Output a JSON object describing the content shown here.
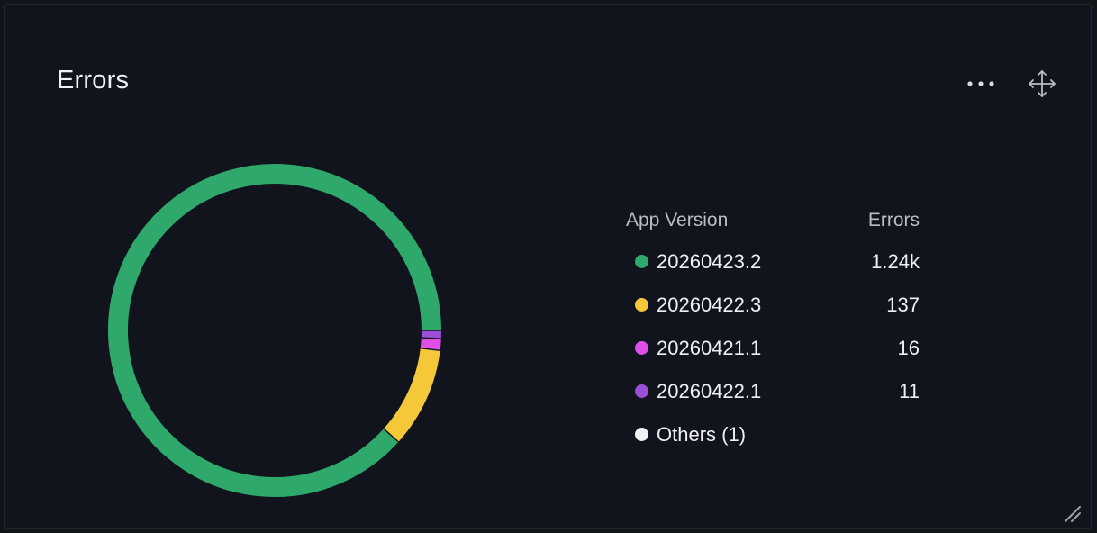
{
  "panel": {
    "title": "Errors",
    "menu_icon": "more-horizontal-icon",
    "move_icon": "move-arrows-icon",
    "resize_icon": "resize-handle-icon"
  },
  "colors": {
    "background": "#11141c",
    "green": "#2ea86b",
    "yellow": "#f5c839",
    "magenta": "#df4fe7",
    "purple": "#9a4fd8",
    "white": "#f2f3f5"
  },
  "chart_data": {
    "type": "pie",
    "title": "Errors",
    "legend_headers": [
      "App Version",
      "Errors"
    ],
    "series": [
      {
        "name": "20260423.2",
        "label": "1.24k",
        "value": 1240,
        "color": "#2ea86b"
      },
      {
        "name": "20260422.3",
        "label": "137",
        "value": 137,
        "color": "#f5c839"
      },
      {
        "name": "20260421.1",
        "label": "16",
        "value": 16,
        "color": "#df4fe7"
      },
      {
        "name": "20260422.1",
        "label": "11",
        "value": 11,
        "color": "#9a4fd8"
      },
      {
        "name": "Others (1)",
        "label": "",
        "value": 0,
        "color": "#f2f3f5"
      }
    ],
    "donut": true,
    "start_angle_deg": 0,
    "direction": "counterclockwise",
    "legend_position": "right"
  }
}
